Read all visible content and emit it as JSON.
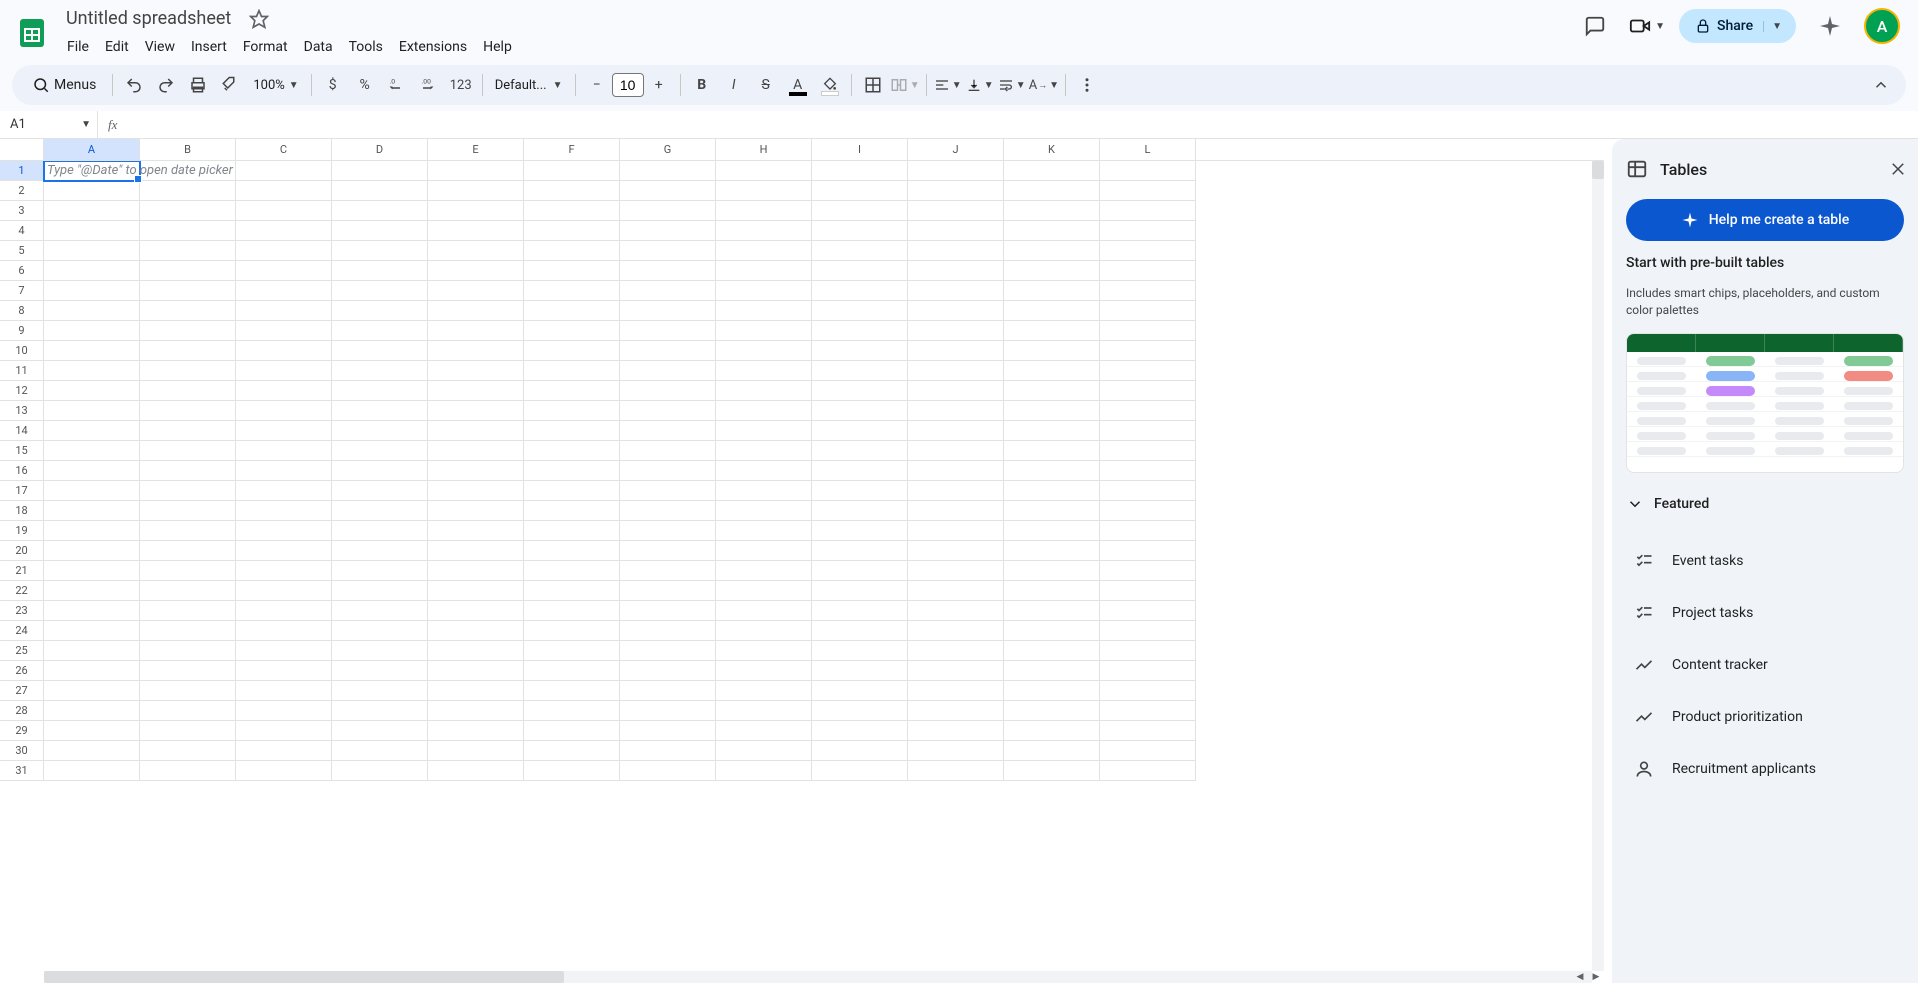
{
  "header": {
    "doc_title": "Untitled spreadsheet",
    "menus": [
      "File",
      "Edit",
      "View",
      "Insert",
      "Format",
      "Data",
      "Tools",
      "Extensions",
      "Help"
    ],
    "share_label": "Share",
    "avatar_letter": "A"
  },
  "toolbar": {
    "menus_label": "Menus",
    "zoom": "100%",
    "font_name": "Default...",
    "font_size": "10",
    "number_format_label": "123"
  },
  "namebox": {
    "cell_ref": "A1"
  },
  "grid": {
    "columns": [
      "A",
      "B",
      "C",
      "D",
      "E",
      "F",
      "G",
      "H",
      "I",
      "J",
      "K",
      "L"
    ],
    "row_count": 31,
    "active_cell": "A1",
    "placeholder_hint": "Type \"@Date\" to open date picker"
  },
  "side_panel": {
    "title": "Tables",
    "help_button": "Help me create a table",
    "prebuilt_title": "Start with pre-built tables",
    "prebuilt_desc": "Includes smart chips, placeholders, and custom color palettes",
    "section_featured": "Featured",
    "items": [
      {
        "label": "Event tasks",
        "icon": "checklist"
      },
      {
        "label": "Project tasks",
        "icon": "checklist"
      },
      {
        "label": "Content tracker",
        "icon": "trend"
      },
      {
        "label": "Product prioritization",
        "icon": "trend"
      },
      {
        "label": "Recruitment applicants",
        "icon": "person"
      }
    ]
  }
}
